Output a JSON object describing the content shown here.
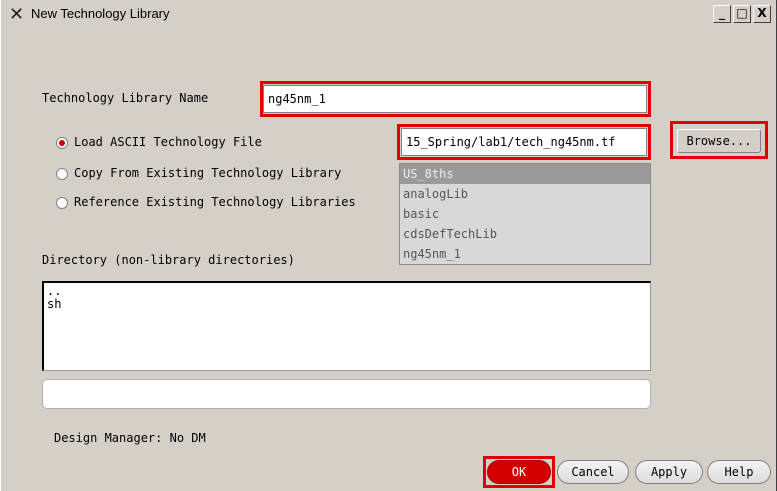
{
  "window": {
    "title": "New Technology Library",
    "icon": "x-window-icon",
    "controls": {
      "minimize": "_",
      "maximize": "□",
      "close": "X"
    }
  },
  "form": {
    "name_label": "Technology Library Name",
    "name_value": "ng45nm_1",
    "options": [
      {
        "label": "Load ASCII Technology File",
        "selected": true
      },
      {
        "label": "Copy From Existing Technology Library",
        "selected": false
      },
      {
        "label": "Reference Existing Technology Libraries",
        "selected": false
      }
    ],
    "ascii_file_value": "15_Spring/lab1/tech_ng45nm.tf",
    "browse_label": "Browse...",
    "library_list": [
      "US_8ths",
      "analogLib",
      "basic",
      "cdsDefTechLib",
      "ng45nm_1"
    ],
    "library_list_selected": "US_8ths",
    "directory_label": "Directory (non-library directories)",
    "directory_items": [
      "..",
      "sh"
    ],
    "directory_field_value": "",
    "design_manager": "Design Manager: No DM"
  },
  "buttons": {
    "ok": "OK",
    "cancel": "Cancel",
    "apply": "Apply",
    "help": "Help"
  },
  "colors": {
    "highlight": "#e00000",
    "ok_button": "#d40000",
    "dialog_bg": "#d4d0c8"
  }
}
